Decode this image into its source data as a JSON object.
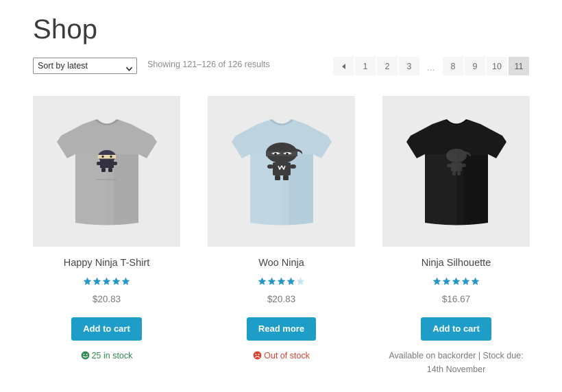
{
  "page": {
    "title": "Shop"
  },
  "toolbar": {
    "orderby": {
      "selected": "Sort by latest",
      "icon": "chevron-down-icon",
      "options": [
        "Sort by latest"
      ]
    },
    "result_count": "Showing 121–126 of 126 results"
  },
  "pagination": {
    "prev_icon": "arrow-left-icon",
    "items": [
      {
        "label": "1",
        "current": false
      },
      {
        "label": "2",
        "current": false
      },
      {
        "label": "3",
        "current": false
      },
      {
        "label": "…",
        "current": false,
        "dots": true
      },
      {
        "label": "8",
        "current": false
      },
      {
        "label": "9",
        "current": false
      },
      {
        "label": "10",
        "current": false
      },
      {
        "label": "11",
        "current": true
      }
    ]
  },
  "colors": {
    "accent": "#1e9dc8",
    "star": "#2698c4",
    "star_empty": "#c5e5f0",
    "in_stock": "#2f8a4e",
    "out_of_stock": "#d8402f",
    "muted": "#77797c",
    "thumb_bg": "#ebebeb",
    "page_bg": "#f6f6f6",
    "page_current_bg": "#dcdcdc"
  },
  "products": [
    {
      "title": "Happy Ninja T-Shirt",
      "rating": 5,
      "price": "$20.83",
      "button_label": "Add to cart",
      "stock_text": "25 in stock",
      "stock_state": "in-stock",
      "stock_icon": "smiley-face-icon",
      "shirt_color": "#b0b0b0",
      "shirt_shadow": "#9a9a9a",
      "graphic": "happy-ninja-graphic"
    },
    {
      "title": "Woo Ninja",
      "rating": 4,
      "price": "$20.83",
      "button_label": "Read more",
      "stock_text": "Out of stock",
      "stock_state": "out-of-stock",
      "stock_icon": "frowning-face-icon",
      "shirt_color": "#bdd3e0",
      "shirt_shadow": "#a6bfcf",
      "graphic": "woo-ninja-graphic"
    },
    {
      "title": "Ninja Silhouette",
      "rating": 5,
      "price": "$16.67",
      "button_label": "Add to cart",
      "stock_text": "Available on backorder | Stock due: 14th November",
      "stock_state": "backorder",
      "stock_icon": "none",
      "shirt_color": "#191919",
      "shirt_shadow": "#0d0d0d",
      "graphic": "ninja-silhouette-graphic"
    }
  ]
}
